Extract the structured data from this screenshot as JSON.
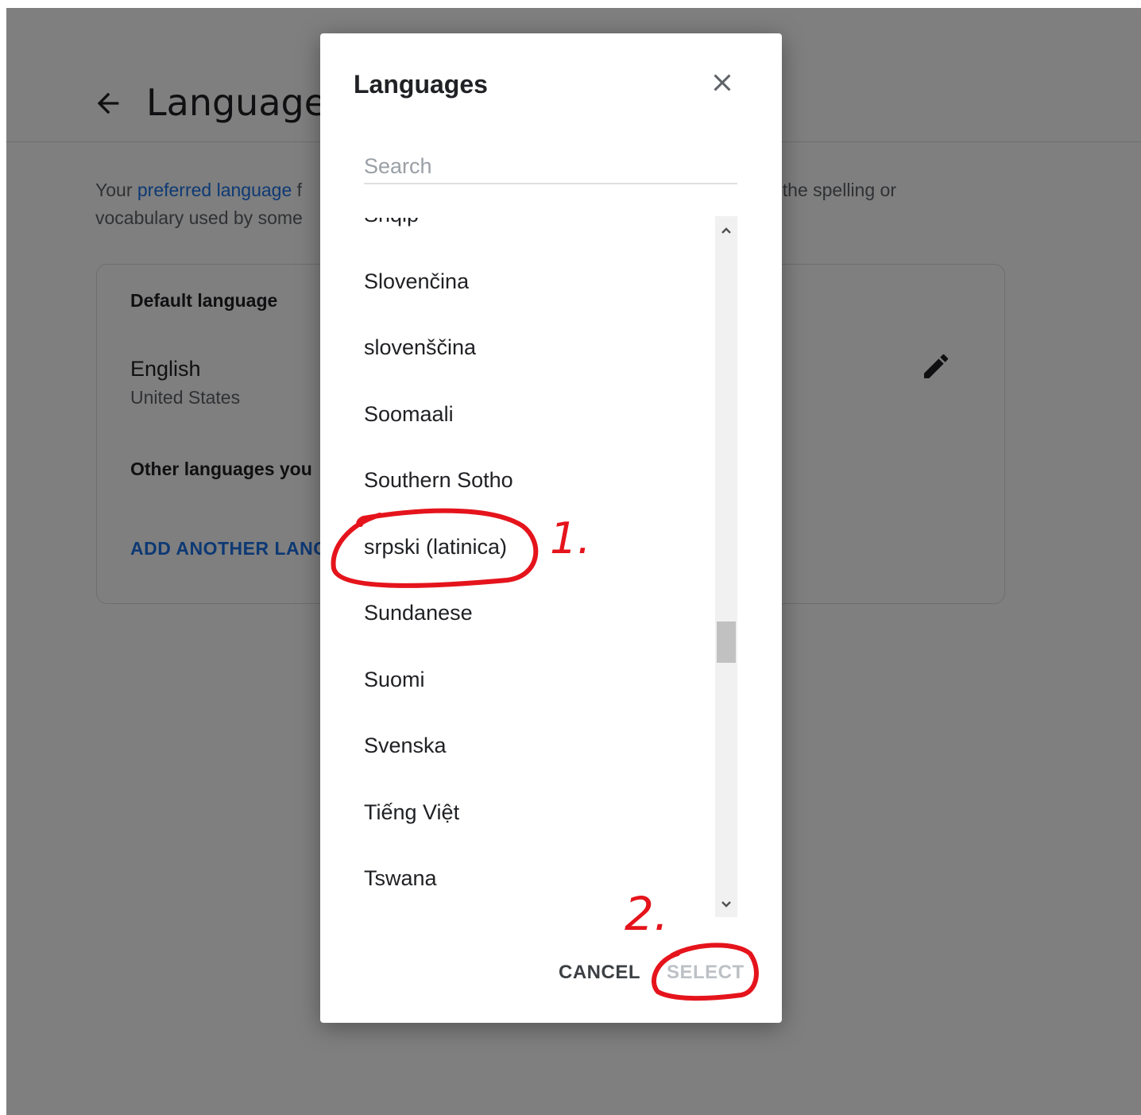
{
  "background_page": {
    "title": "Language",
    "intro_prefix": "Your ",
    "intro_link": "preferred language",
    "intro_after_link": " f",
    "intro_line2": "vocabulary used by some",
    "intro_right": "t the spelling or",
    "default_heading": "Default language",
    "default_language": "English",
    "default_region": "United States",
    "other_heading": "Other languages you",
    "add_link": "ADD ANOTHER LANG"
  },
  "dialog": {
    "title": "Languages",
    "search_placeholder": "Search",
    "items": [
      {
        "label": "Shqip"
      },
      {
        "label": "Slovenčina"
      },
      {
        "label": "slovenščina"
      },
      {
        "label": "Soomaali"
      },
      {
        "label": "Southern Sotho"
      },
      {
        "label": "srpski (latinica)"
      },
      {
        "label": "Sundanese"
      },
      {
        "label": "Suomi"
      },
      {
        "label": "Svenska"
      },
      {
        "label": "Tiếng Việt"
      },
      {
        "label": "Tswana"
      }
    ],
    "cancel_label": "CANCEL",
    "select_label": "SELECT"
  },
  "annotations": {
    "step1": "1.",
    "step2": "2.",
    "color": "#e5141c"
  },
  "colors": {
    "link": "#1a73e8",
    "scrim": "rgba(0,0,0,0.5)",
    "disabled": "#bdc1c6"
  },
  "icons": [
    "arrow-back-icon",
    "pencil-edit-icon",
    "close-icon",
    "chevron-up-icon",
    "chevron-down-icon"
  ]
}
